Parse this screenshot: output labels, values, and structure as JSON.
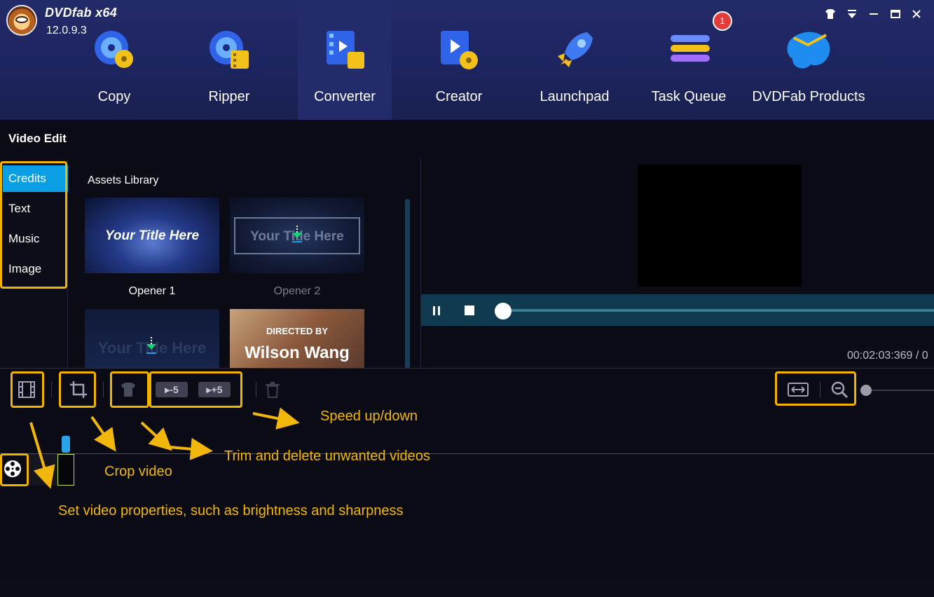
{
  "app": {
    "name": "DVDfab x64",
    "version": "12.0.9.3"
  },
  "nav": [
    "Copy",
    "Ripper",
    "Converter",
    "Creator",
    "Launchpad",
    "Task Queue",
    "DVDFab Products"
  ],
  "badge_count": "1",
  "panel_title": "Video Edit",
  "sidebar": {
    "items": [
      "Credits",
      "Text",
      "Music",
      "Image"
    ],
    "active": "Credits"
  },
  "assets": {
    "title": "Assets Library",
    "items": [
      {
        "caption": "Opener 1",
        "text": "Your Title Here"
      },
      {
        "caption": "Opener 2",
        "text": "Your Title Here"
      },
      {
        "caption": "",
        "text": "Your Title Here"
      },
      {
        "caption": "",
        "text_small": "DIRECTED BY",
        "text": "Wilson Wang"
      }
    ]
  },
  "player": {
    "timecode": "00:02:03:369 / 0"
  },
  "toolbar": {
    "speed_down": "-5",
    "speed_up": "+5"
  },
  "annotations": {
    "speed": "Speed up/down",
    "trim": "Trim and delete unwanted videos",
    "crop": "Crop video",
    "props": "Set video properties, such as brightness and sharpness"
  },
  "colors": {
    "accent": "#0a9fe4",
    "highlight": "#f0b400",
    "annotation": "#f3b70b",
    "topbar": "#1d2560"
  }
}
